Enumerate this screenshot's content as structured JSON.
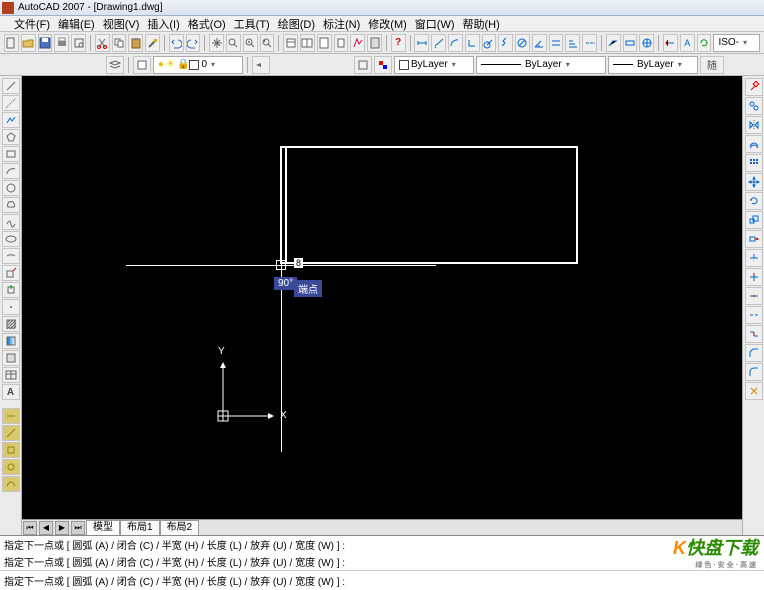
{
  "title": "AutoCAD 2007 - [Drawing1.dwg]",
  "menu": [
    "文件(F)",
    "编辑(E)",
    "视图(V)",
    "插入(I)",
    "格式(O)",
    "工具(T)",
    "绘图(D)",
    "标注(N)",
    "修改(M)",
    "窗口(W)",
    "帮助(H)"
  ],
  "layer": {
    "current": "0"
  },
  "bylayer": {
    "color": "ByLayer",
    "line": "ByLayer",
    "weight": "ByLayer"
  },
  "iso": "ISO-",
  "btn_random": "随",
  "canvas": {
    "angle": "90°",
    "snap": "端点",
    "input": "8",
    "ucs_x": "X",
    "ucs_y": "Y"
  },
  "tabs": {
    "model": "模型",
    "layout1": "布局1",
    "layout2": "布局2"
  },
  "cmd": {
    "line1": "指定下一点或  [ 圆弧 (A) / 闭合 (C) / 半宽 (H) / 长度 (L) / 放弃 (U) / 宽度 (W) ] :",
    "line2": "指定下一点或  [ 圆弧 (A) / 闭合 (C) / 半宽 (H) / 长度 (L) / 放弃 (U) / 宽度 (W) ] :",
    "input": "指定下一点或  [ 圆弧 (A) / 闭合 (C) / 半宽 (H) / 长度 (L) / 放弃 (U) / 宽度 (W) ] :"
  },
  "watermark": {
    "brand_k": "K",
    "brand_rest": "快盘下载",
    "sub": "绿色·安全·高速"
  }
}
